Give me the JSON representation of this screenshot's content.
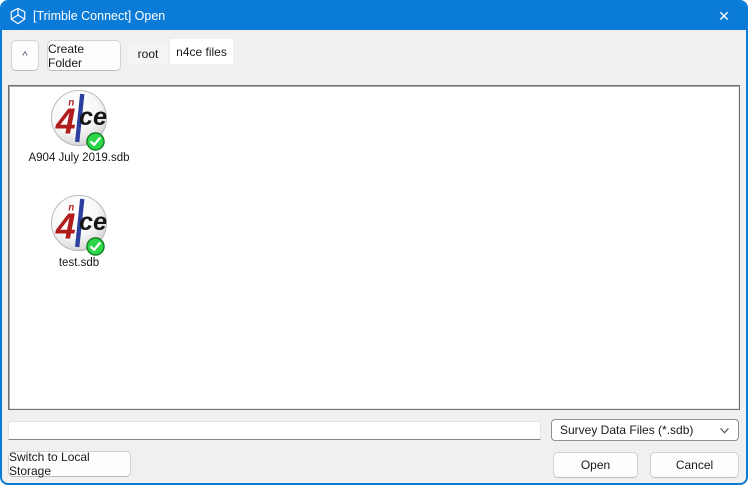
{
  "titlebar": {
    "title": "[Trimble Connect] Open",
    "close_glyph": "✕",
    "logo_icon": "trimble-connect-logo-icon"
  },
  "toolbar": {
    "up_label": "^",
    "create_folder_label": "Create Folder",
    "breadcrumbs": [
      {
        "label": "root"
      },
      {
        "label": "n4ce files"
      }
    ]
  },
  "files": [
    {
      "name": "A904 July 2019.sdb",
      "icon": "n4ce-file-icon",
      "badge": "green-check-badge"
    },
    {
      "name": "test.sdb",
      "icon": "n4ce-file-icon",
      "badge": "green-check-badge"
    }
  ],
  "footer": {
    "filename_value": "",
    "file_type_filter": "Survey Data Files (*.sdb)",
    "switch_storage_label": "Switch to Local Storage",
    "open_label": "Open",
    "cancel_label": "Cancel"
  },
  "colors": {
    "titlebar_blue": "#0b7bd8",
    "window_bg": "#f0f0f0",
    "badge_green": "#2bd647",
    "logo_red": "#b01c1c",
    "logo_blue": "#2c3f9e"
  }
}
